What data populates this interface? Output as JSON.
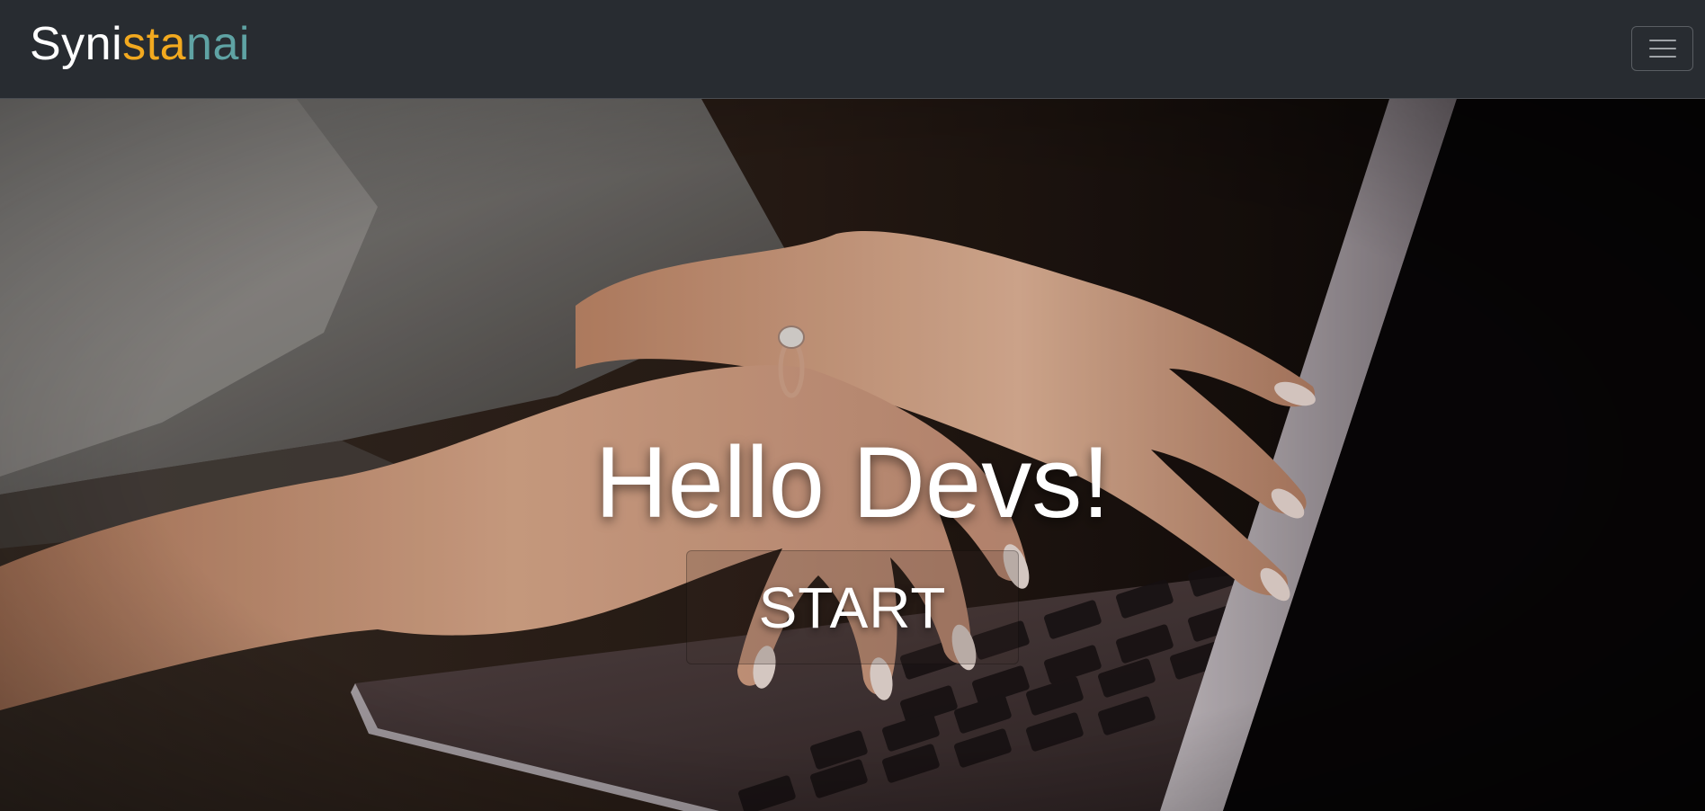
{
  "navbar": {
    "brand": {
      "parts": [
        {
          "text": "Syni",
          "color": "#ffffff"
        },
        {
          "text": "sta",
          "color": "#f2a91f"
        },
        {
          "text": "nai",
          "color": "#5fa3a4"
        }
      ]
    },
    "menu_icon": "hamburger-menu-icon",
    "background": "#282c31"
  },
  "hero": {
    "image": "hands-typing-on-laptop-photo",
    "title": "Hello Devs!",
    "button_label": "START"
  }
}
